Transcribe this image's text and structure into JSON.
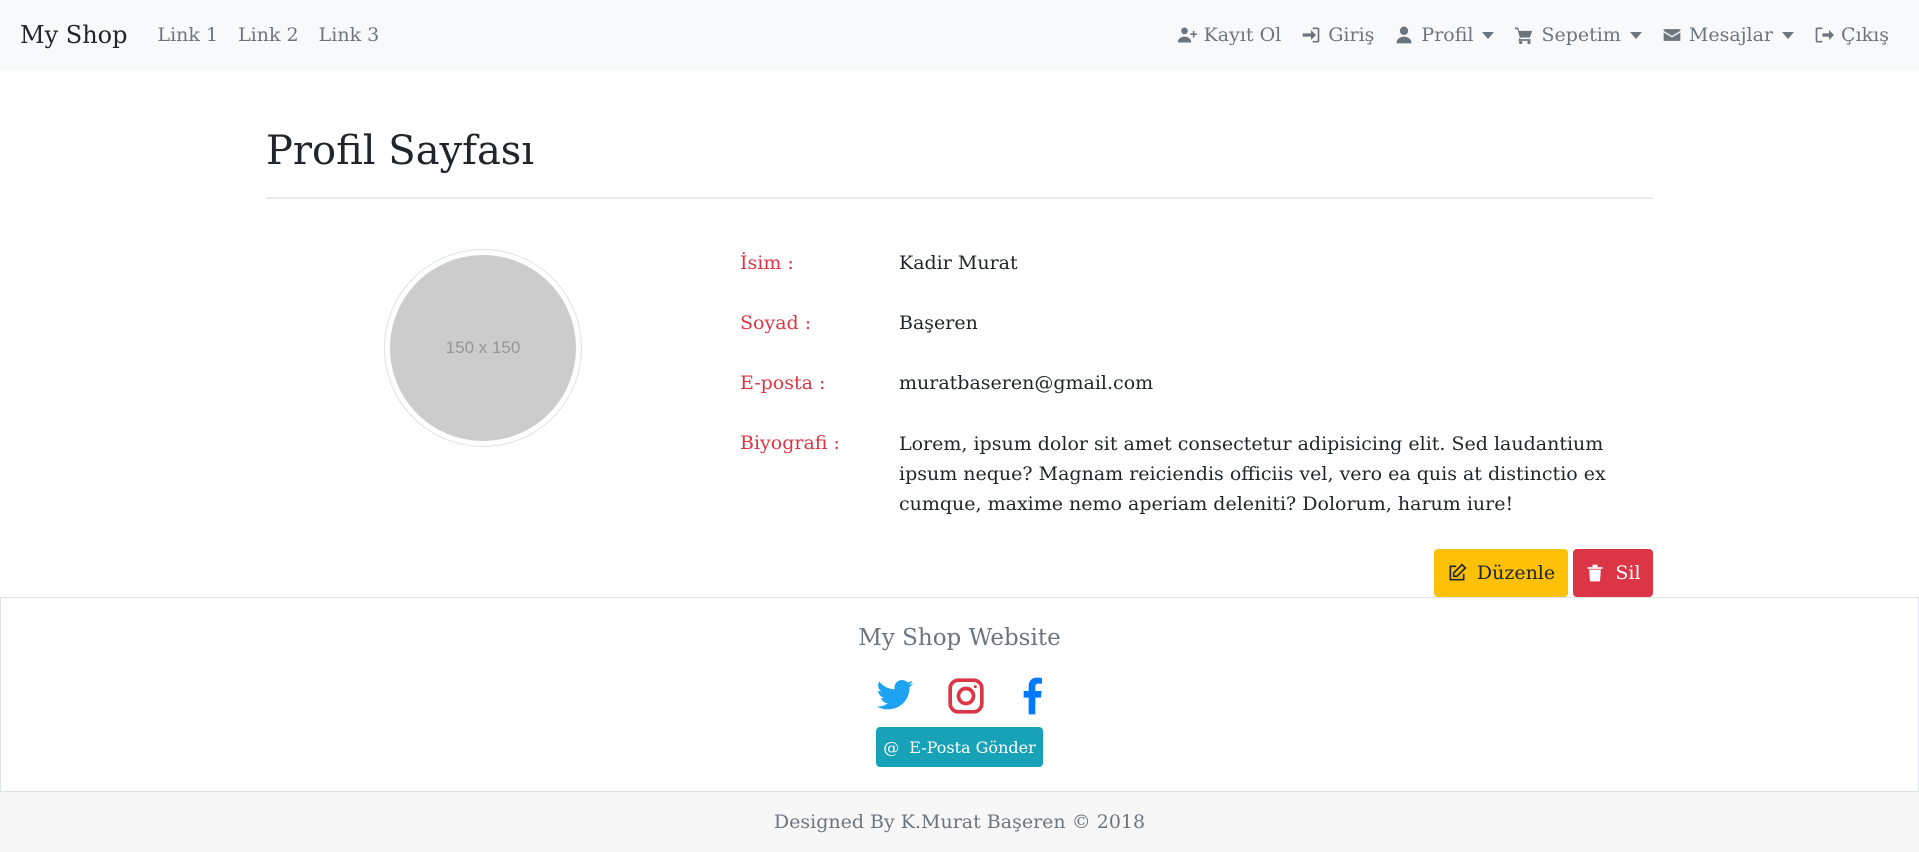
{
  "navbar": {
    "brand": "My Shop",
    "links": [
      "Link 1",
      "Link 2",
      "Link 3"
    ],
    "right_items": [
      {
        "label": "Kayıt Ol",
        "icon": "user-plus-icon"
      },
      {
        "label": "Giriş",
        "icon": "sign-in-icon"
      },
      {
        "label": "Profil",
        "icon": "user-icon",
        "dropdown": true
      },
      {
        "label": "Sepetim",
        "icon": "cart-icon",
        "dropdown": true
      },
      {
        "label": "Mesajlar",
        "icon": "envelope-icon",
        "dropdown": true
      },
      {
        "label": "Çıkış",
        "icon": "sign-out-icon"
      }
    ]
  },
  "profile": {
    "title": "Profil Sayfası",
    "avatar_placeholder": "150 x 150",
    "fields": [
      {
        "label": "İsim :",
        "value": "Kadir Murat"
      },
      {
        "label": "Soyad :",
        "value": "Başeren"
      },
      {
        "label": "E-posta :",
        "value": "muratbaseren@gmail.com"
      },
      {
        "label": "Biyografi :",
        "value": "Lorem, ipsum dolor sit amet consectetur adipisicing elit. Sed laudantium ipsum neque? Magnam reiciendis officiis vel, vero ea quis at distinctio ex cumque, maxime nemo aperiam deleniti? Dolorum, harum iure!"
      }
    ],
    "edit_label": "Düzenle",
    "delete_label": "Sil"
  },
  "footer": {
    "title": "My Shop Website",
    "social_icons": [
      "twitter-icon",
      "instagram-icon",
      "facebook-icon"
    ],
    "mail_button": "E-Posta Gönder",
    "copyright": "Designed By K.Murat Başeren © 2018"
  },
  "colors": {
    "label_red": "#dc3545",
    "edit_yellow": "#ffc107",
    "delete_red": "#dc3545",
    "mail_teal": "#17a2b8",
    "twitter_blue": "#1da1f2",
    "instagram_red": "#dc3545",
    "facebook_blue": "#007bff"
  }
}
